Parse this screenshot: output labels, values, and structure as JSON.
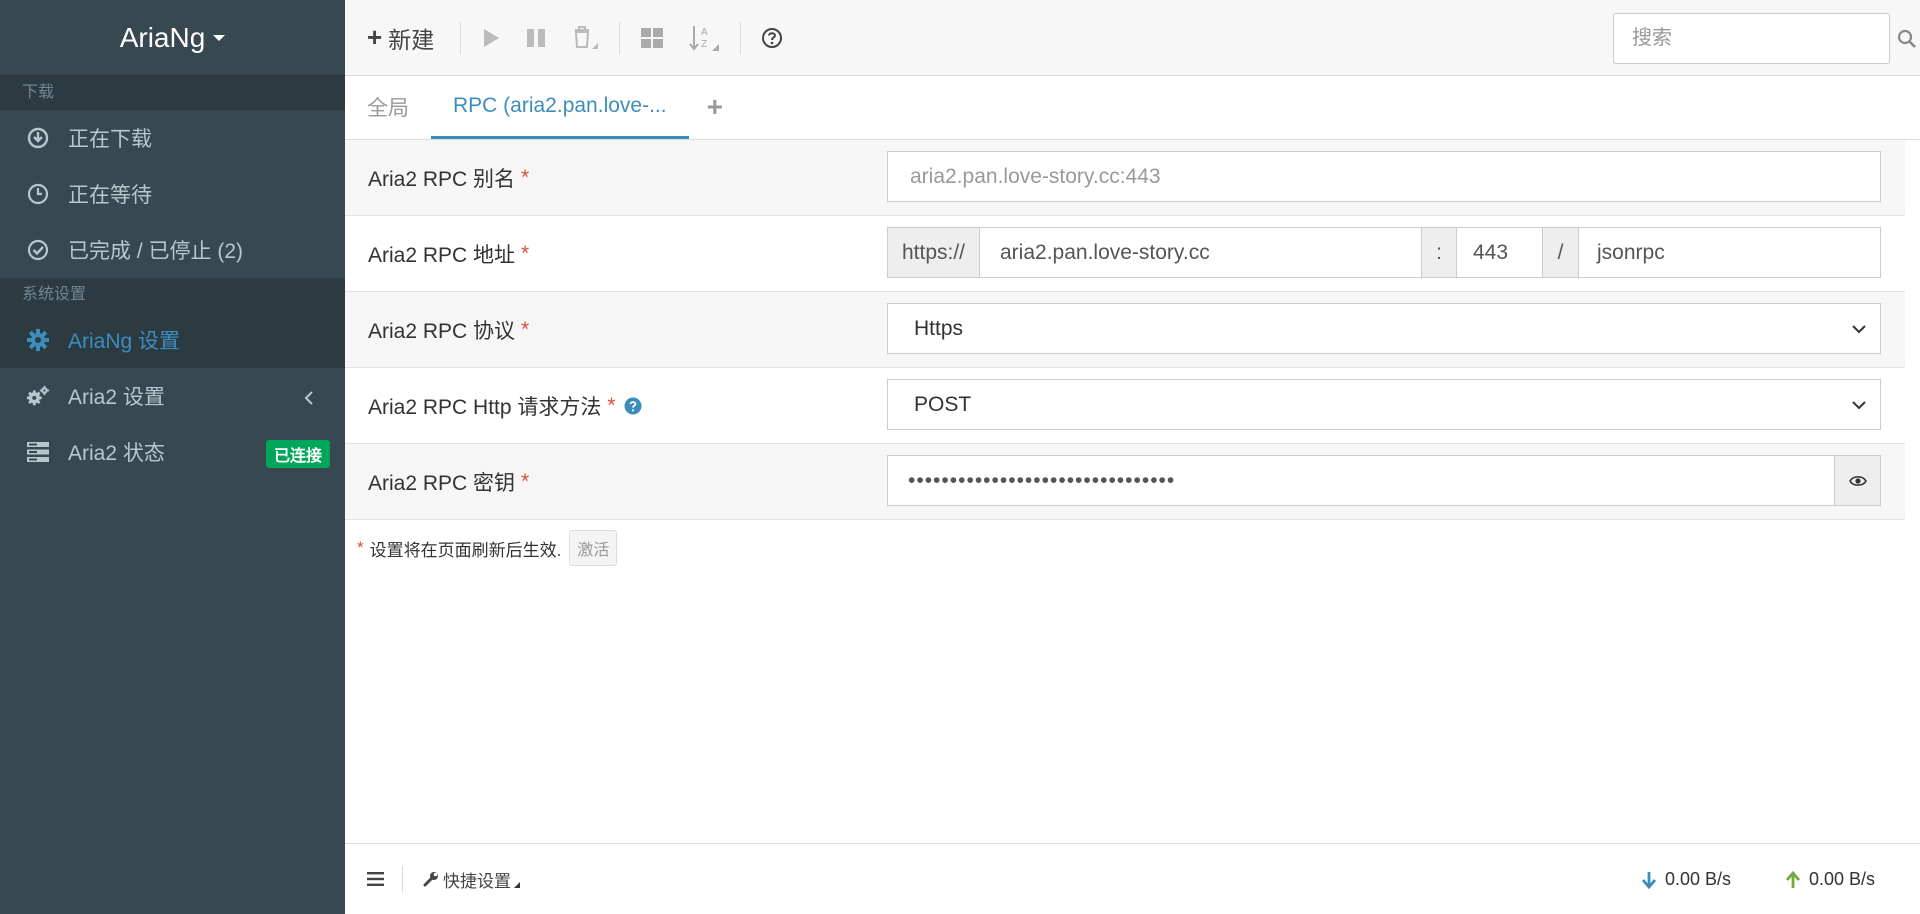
{
  "app": {
    "title": "AriaNg"
  },
  "sidebar": {
    "download_header": "下载",
    "items": [
      {
        "label": "正在下载",
        "icon": "download-circle-icon"
      },
      {
        "label": "正在等待",
        "icon": "clock-icon"
      },
      {
        "label": "已完成 / 已停止 (2)",
        "icon": "check-circle-icon"
      }
    ],
    "settings_header": "系统设置",
    "settings_items": [
      {
        "label": "AriaNg 设置",
        "icon": "gear-icon",
        "active": true
      },
      {
        "label": "Aria2 设置",
        "icon": "gears-icon"
      },
      {
        "label": "Aria2 状态",
        "icon": "server-icon",
        "badge": "已连接"
      }
    ]
  },
  "toolbar": {
    "new_label": "新建",
    "icons": [
      "play-icon",
      "pause-icon",
      "trash-icon",
      "grid-icon",
      "sort-icon",
      "help-icon"
    ]
  },
  "search": {
    "placeholder": "搜索"
  },
  "tabs": {
    "global": "全局",
    "rpc": "RPC (aria2.pan.love-..."
  },
  "settings": {
    "alias": {
      "label": "Aria2 RPC 别名",
      "required": "*",
      "placeholder": "aria2.pan.love-story.cc:443"
    },
    "address": {
      "label": "Aria2 RPC 地址",
      "required": "*",
      "protocol_prefix": "https://",
      "host": "aria2.pan.love-story.cc",
      "colon": ":",
      "port": "443",
      "slash": "/",
      "path": "jsonrpc"
    },
    "protocol": {
      "label": "Aria2 RPC 协议",
      "required": "*",
      "value": "Https"
    },
    "method": {
      "label": "Aria2 RPC Http 请求方法",
      "required": "*",
      "value": "POST"
    },
    "secret": {
      "label": "Aria2 RPC 密钥",
      "required": "*",
      "masked_value": "••••••••••••••••••••••••••••••••"
    }
  },
  "note": {
    "required": "*",
    "text": "设置将在页面刷新后生效.",
    "button": "激活"
  },
  "footer": {
    "quick_settings": "快捷设置",
    "download_speed": "0.00 B/s",
    "upload_speed": "0.00 B/s"
  },
  "colors": {
    "sidebar_bg": "#374850",
    "accent": "#3c8dbc",
    "connected": "#00a65a",
    "required": "#dd4b39"
  }
}
